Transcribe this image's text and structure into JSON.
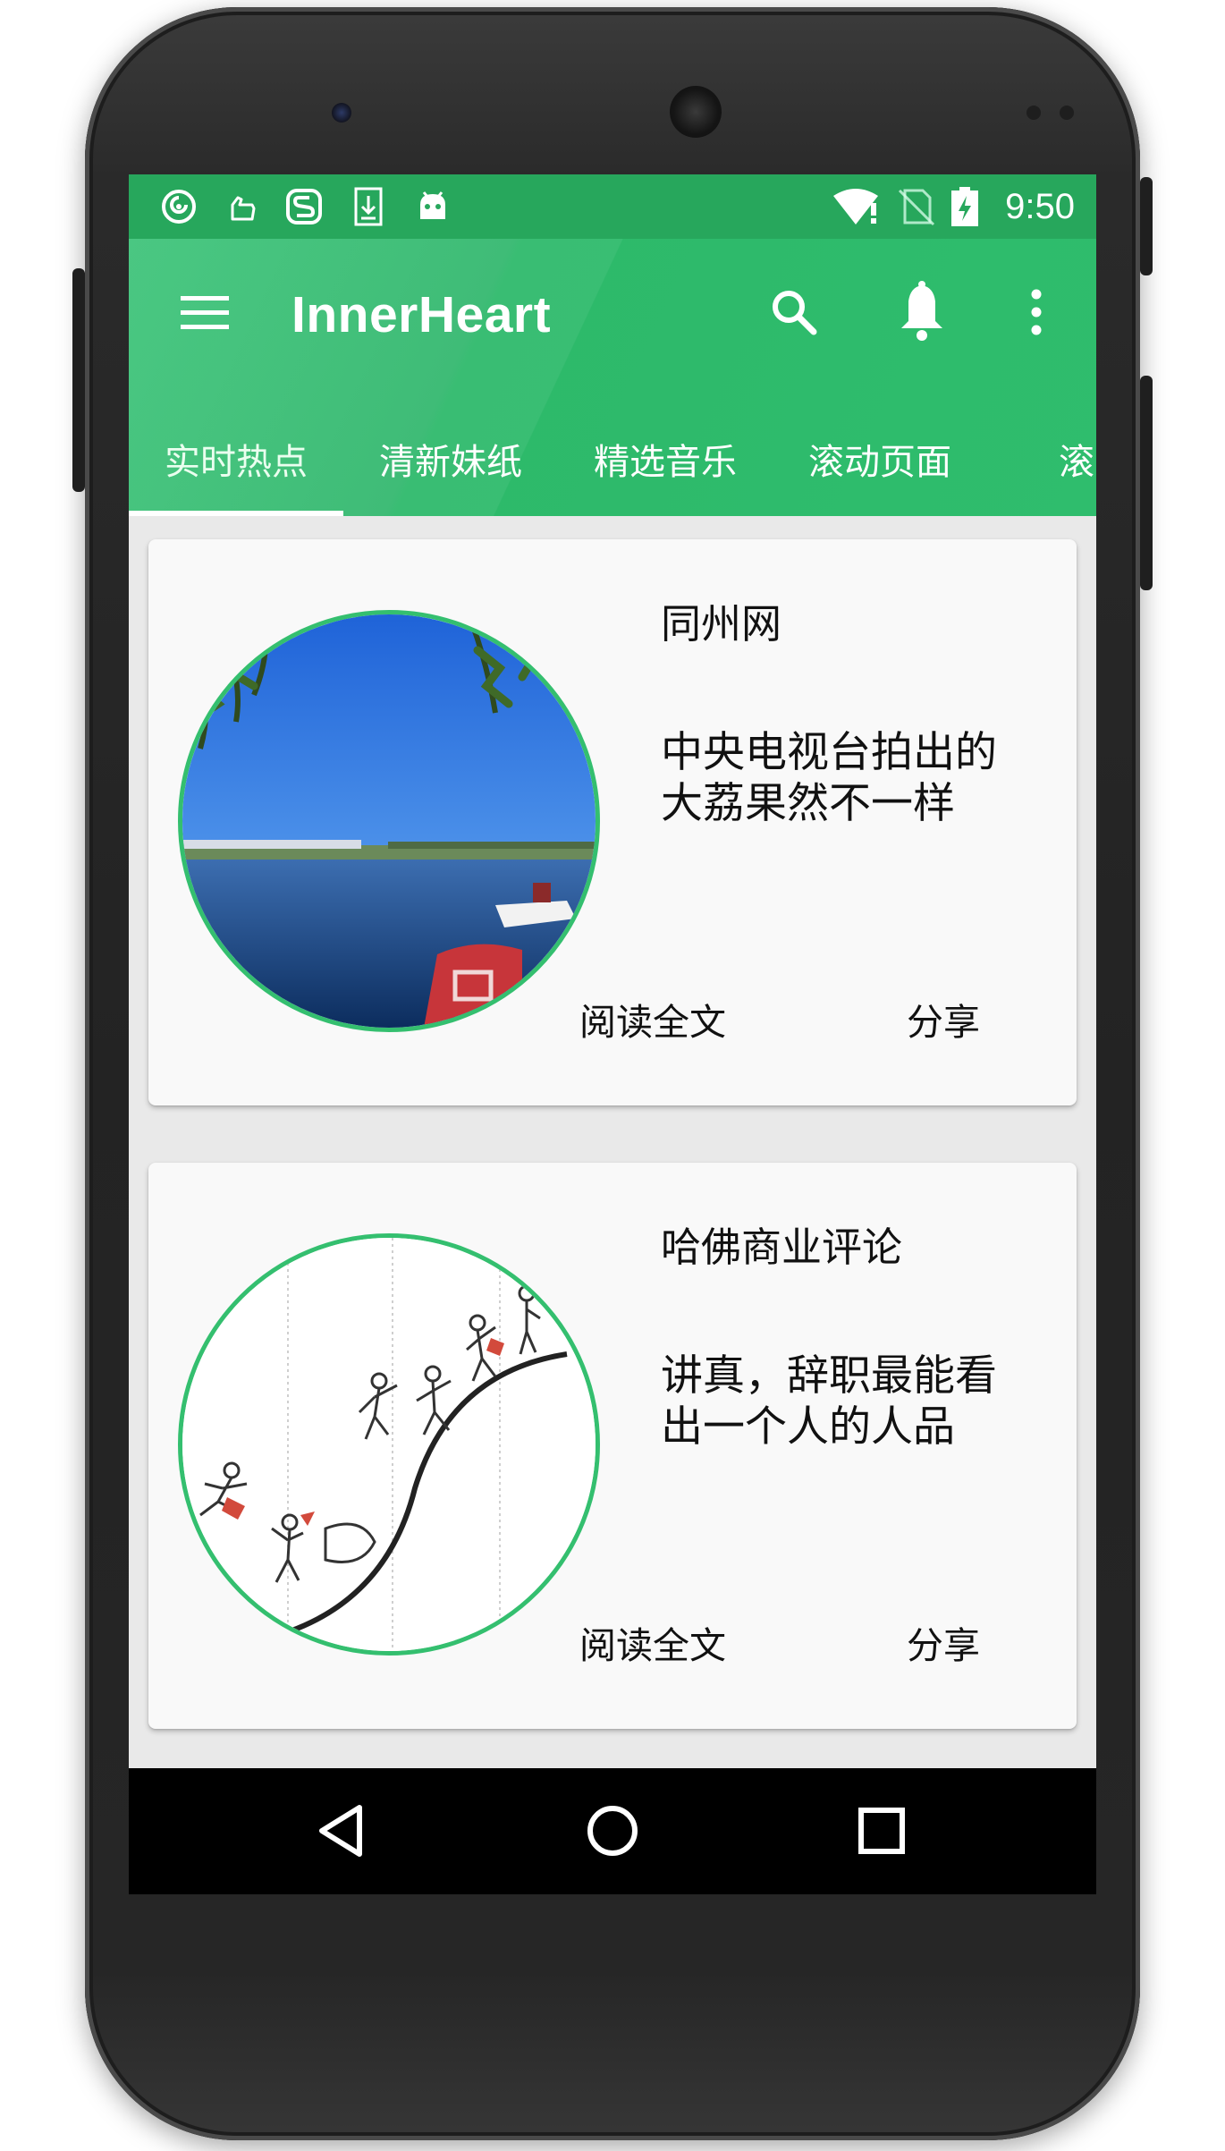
{
  "status_bar": {
    "time": "9:50",
    "left_icons": [
      "netease-music-icon",
      "hand-icon",
      "swift-icon",
      "download-icon",
      "android-icon"
    ],
    "right_icons": [
      "wifi-alert-icon",
      "no-sim-icon",
      "battery-charging-icon"
    ]
  },
  "app_bar": {
    "title": "InnerHeart",
    "background_color": "#2fbd6d",
    "actions": [
      "search-icon",
      "notifications-icon",
      "more-vert-icon"
    ]
  },
  "tabs": [
    {
      "label": "实时热点",
      "active": true
    },
    {
      "label": "清新妹纸",
      "active": false
    },
    {
      "label": "精选音乐",
      "active": false
    },
    {
      "label": "滚动页面",
      "active": false
    },
    {
      "label": "滚动",
      "active": false
    }
  ],
  "cards": [
    {
      "source": "同州网",
      "headline": "中央电视台拍出的大荔果然不一样",
      "read_label": "阅读全文",
      "share_label": "分享",
      "image": "lake-landscape"
    },
    {
      "source": "哈佛商业评论",
      "headline": "讲真，辞职最能看出一个人的人品",
      "read_label": "阅读全文",
      "share_label": "分享",
      "image": "curve-climbers-illustration"
    }
  ],
  "nav_bar": [
    "back-icon",
    "home-icon",
    "recents-icon"
  ],
  "colors": {
    "accent": "#34bf6f",
    "status_bar": "#27a75c",
    "card_background": "#f9f9f9"
  }
}
